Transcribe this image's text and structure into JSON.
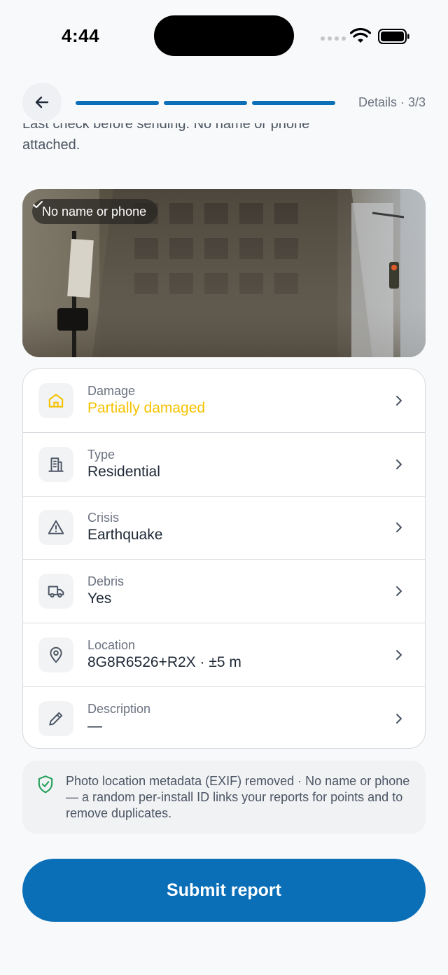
{
  "status_bar": {
    "time": "4:44"
  },
  "header": {
    "step_label": "Details · 3/3",
    "progress_steps": 3,
    "progress_completed": 3
  },
  "intro": {
    "line1": "Last check before sending. No name or phone",
    "line2": "attached."
  },
  "photo": {
    "badge": "No name or phone"
  },
  "fields": [
    {
      "label": "Damage",
      "value": "Partially damaged",
      "icon": "home-icon",
      "value_color": "#f5c200"
    },
    {
      "label": "Type",
      "value": "Residential",
      "icon": "building-icon"
    },
    {
      "label": "Crisis",
      "value": "Earthquake",
      "icon": "warning-icon"
    },
    {
      "label": "Debris",
      "value": "Yes",
      "icon": "truck-icon"
    },
    {
      "label": "Location",
      "value": "8G8R6526+R2X · ±5 m",
      "icon": "pin-icon"
    },
    {
      "label": "Description",
      "value": "—",
      "icon": "pencil-icon"
    }
  ],
  "notice": {
    "text": "Photo location metadata (EXIF) removed · No name or phone — a random per-install ID links your reports for points and to remove duplicates.",
    "icon": "shield-check-icon"
  },
  "submit": {
    "label": "Submit report"
  },
  "colors": {
    "primary": "#0b6fb8",
    "warning": "#f5c200",
    "success": "#22a05a"
  }
}
